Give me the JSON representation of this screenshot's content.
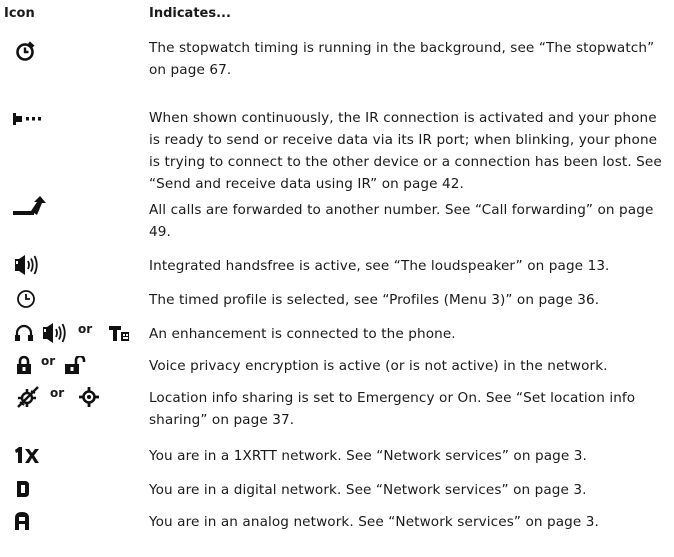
{
  "header": {
    "icon": "Icon",
    "indicates": "Indicates..."
  },
  "rows": [
    {
      "icons": [
        "stopwatch-icon"
      ],
      "text": "The stopwatch timing is running in the background, see “The stopwatch” on page 67."
    },
    {
      "icons": [
        "ir-connection-icon"
      ],
      "text": "When shown continuously, the IR connection is activated and your phone is ready to send or receive data via its IR port; when blinking, your phone is trying to connect to the other device or a connection has been lost. See “Send and receive data using IR” on page 42."
    },
    {
      "icons": [
        "call-forward-icon"
      ],
      "text": "All calls are forwarded to another number. See “Call forwarding” on page 49."
    },
    {
      "icons": [
        "loudspeaker-icon"
      ],
      "text": "Integrated handsfree is active, see “The loudspeaker” on page 13."
    },
    {
      "icons": [
        "timed-profile-icon"
      ],
      "text": "The timed profile is selected, see “Profiles (Menu 3)” on page 36."
    },
    {
      "icons": [
        "headset-icon",
        "loudspeaker-icon",
        "tty-icon"
      ],
      "or_label": "or",
      "text": "An enhancement is connected to the phone."
    },
    {
      "icons": [
        "lock-closed-icon",
        "lock-open-icon"
      ],
      "or_label": "or",
      "text": "Voice privacy encryption is active (or is not active) in the network."
    },
    {
      "icons": [
        "location-off-icon",
        "location-on-icon"
      ],
      "or_label": "or",
      "text": "Location info sharing is set to Emergency or On. See “Set location info sharing” on page 37."
    },
    {
      "icons": [
        "1x-network-icon"
      ],
      "text": "You are in a 1XRTT network. See “Network services” on page 3."
    },
    {
      "icons": [
        "digital-network-icon"
      ],
      "text": "You are in a digital network. See “Network services” on page 3."
    },
    {
      "icons": [
        "analog-network-icon"
      ],
      "text": "You are in an analog network. See “Network services” on page 3."
    }
  ]
}
